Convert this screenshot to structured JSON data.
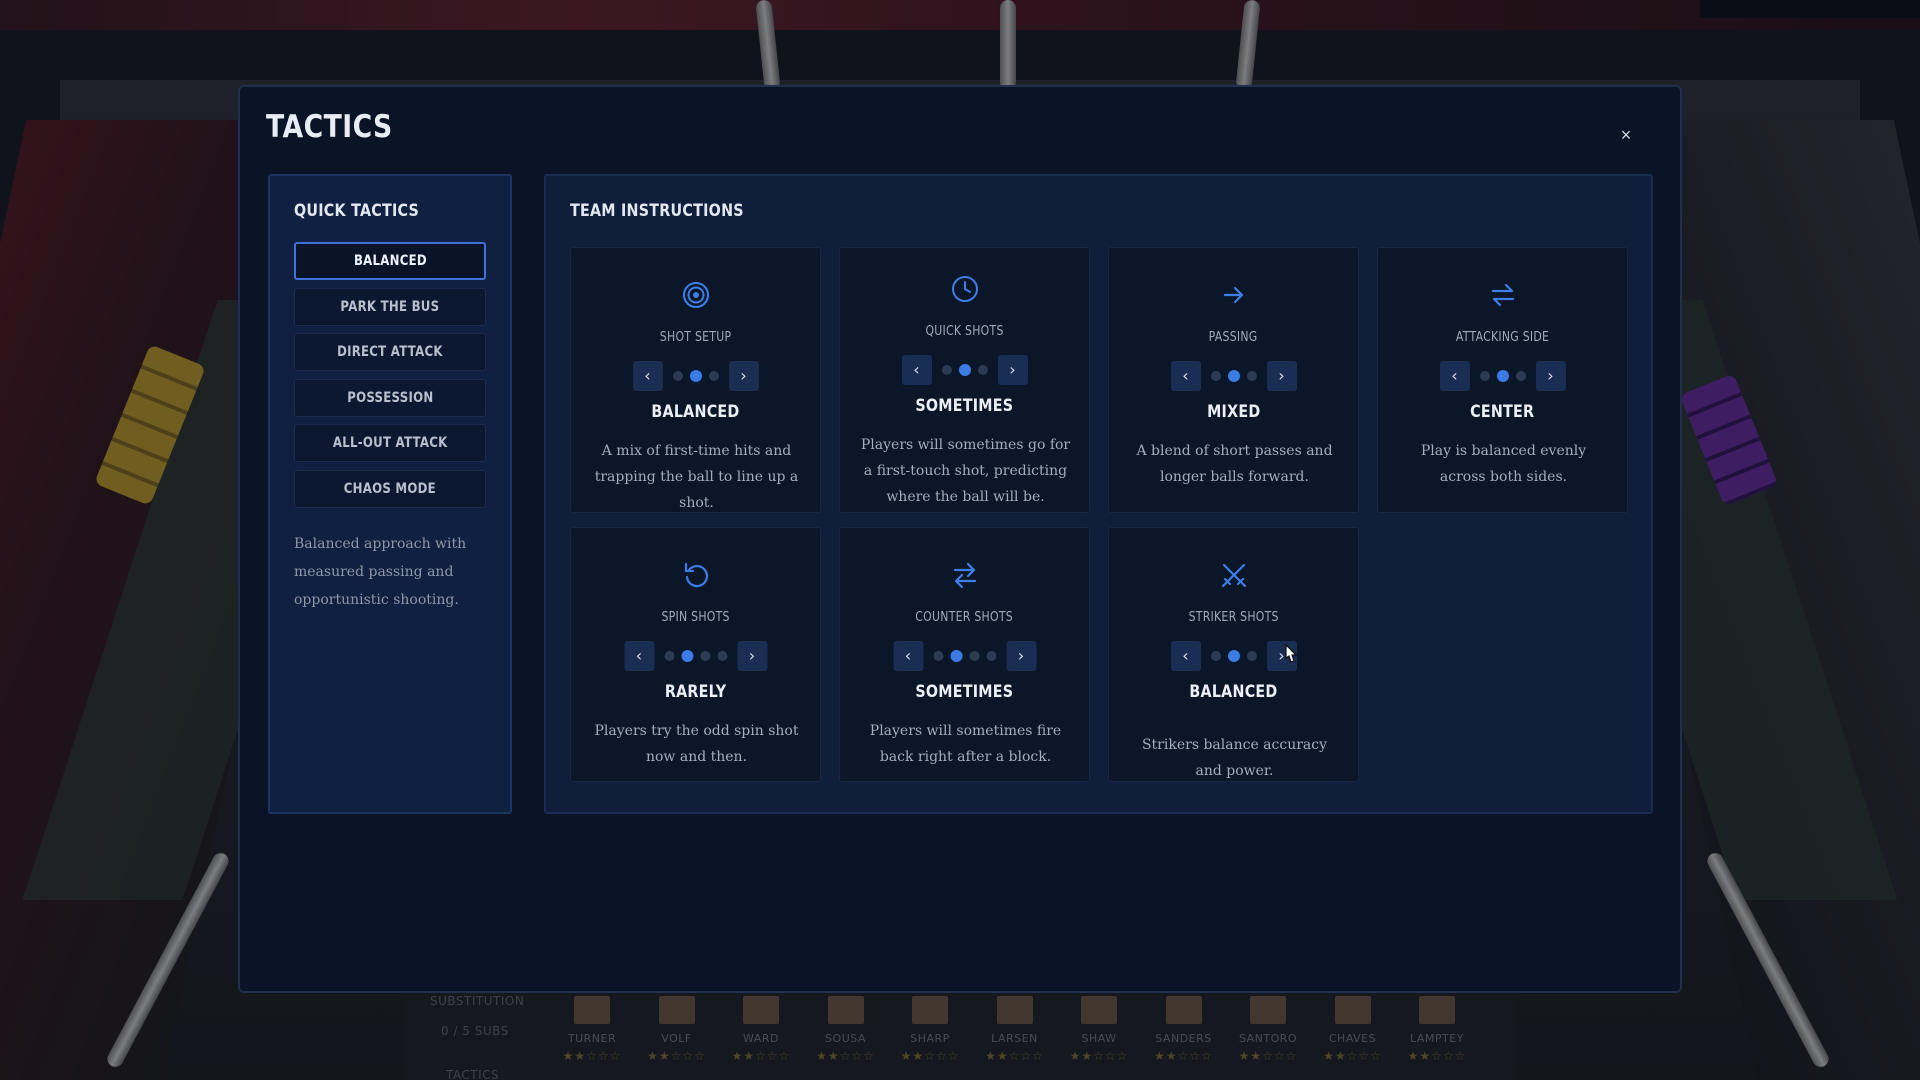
{
  "modal": {
    "title": "TACTICS",
    "close_label": "×"
  },
  "quick_tactics": {
    "title": "QUICK TACTICS",
    "options": [
      "BALANCED",
      "PARK THE BUS",
      "DIRECT ATTACK",
      "POSSESSION",
      "ALL-OUT ATTACK",
      "CHAOS MODE"
    ],
    "selected": "BALANCED",
    "description": "Balanced approach with measured passing and opportunistic shooting."
  },
  "team_instructions": {
    "title": "TEAM INSTRUCTIONS",
    "cards": [
      {
        "label": "SHOT SETUP",
        "icon": "target-icon",
        "levels": 3,
        "selected_index": 1,
        "value": "BALANCED",
        "description": "A mix of first-time hits and trapping the ball to line up a shot."
      },
      {
        "label": "QUICK SHOTS",
        "icon": "clock-icon",
        "levels": 3,
        "selected_index": 1,
        "value": "SOMETIMES",
        "description": "Players will sometimes go for a first-touch shot, predicting where the ball will be."
      },
      {
        "label": "PASSING",
        "icon": "arrow-right-icon",
        "levels": 3,
        "selected_index": 1,
        "value": "MIXED",
        "description": "A blend of short passes and longer balls forward."
      },
      {
        "label": "ATTACKING SIDE",
        "icon": "swap-arrows-icon",
        "levels": 3,
        "selected_index": 1,
        "value": "CENTER",
        "description": "Play is balanced evenly across both sides."
      },
      {
        "label": "SPIN SHOTS",
        "icon": "rotate-icon",
        "levels": 4,
        "selected_index": 1,
        "value": "RARELY",
        "description": "Players try the odd spin shot now and then."
      },
      {
        "label": "COUNTER SHOTS",
        "icon": "exchange-icon",
        "levels": 4,
        "selected_index": 1,
        "value": "SOMETIMES",
        "description": "Players will sometimes fire back right after a block."
      },
      {
        "label": "STRIKER SHOTS",
        "icon": "crossed-swords-icon",
        "levels": 3,
        "selected_index": 1,
        "value": "BALANCED",
        "description": "Strikers balance accuracy and power."
      }
    ]
  },
  "background": {
    "substitution_label": "SUBSTITUTION",
    "subs_count": "0 / 5 SUBS",
    "tactics_label": "TACTICS",
    "players": [
      "TURNER",
      "VOLF",
      "WARD",
      "SOUSA",
      "SHARP",
      "LARSEN",
      "SHAW",
      "SANDERS",
      "SANTORO",
      "CHAVES",
      "LAMPTEY"
    ]
  },
  "colors": {
    "accent": "#3a7be6",
    "modal_bg": "#0b1427",
    "panel_bg": "#0f1e3b"
  }
}
